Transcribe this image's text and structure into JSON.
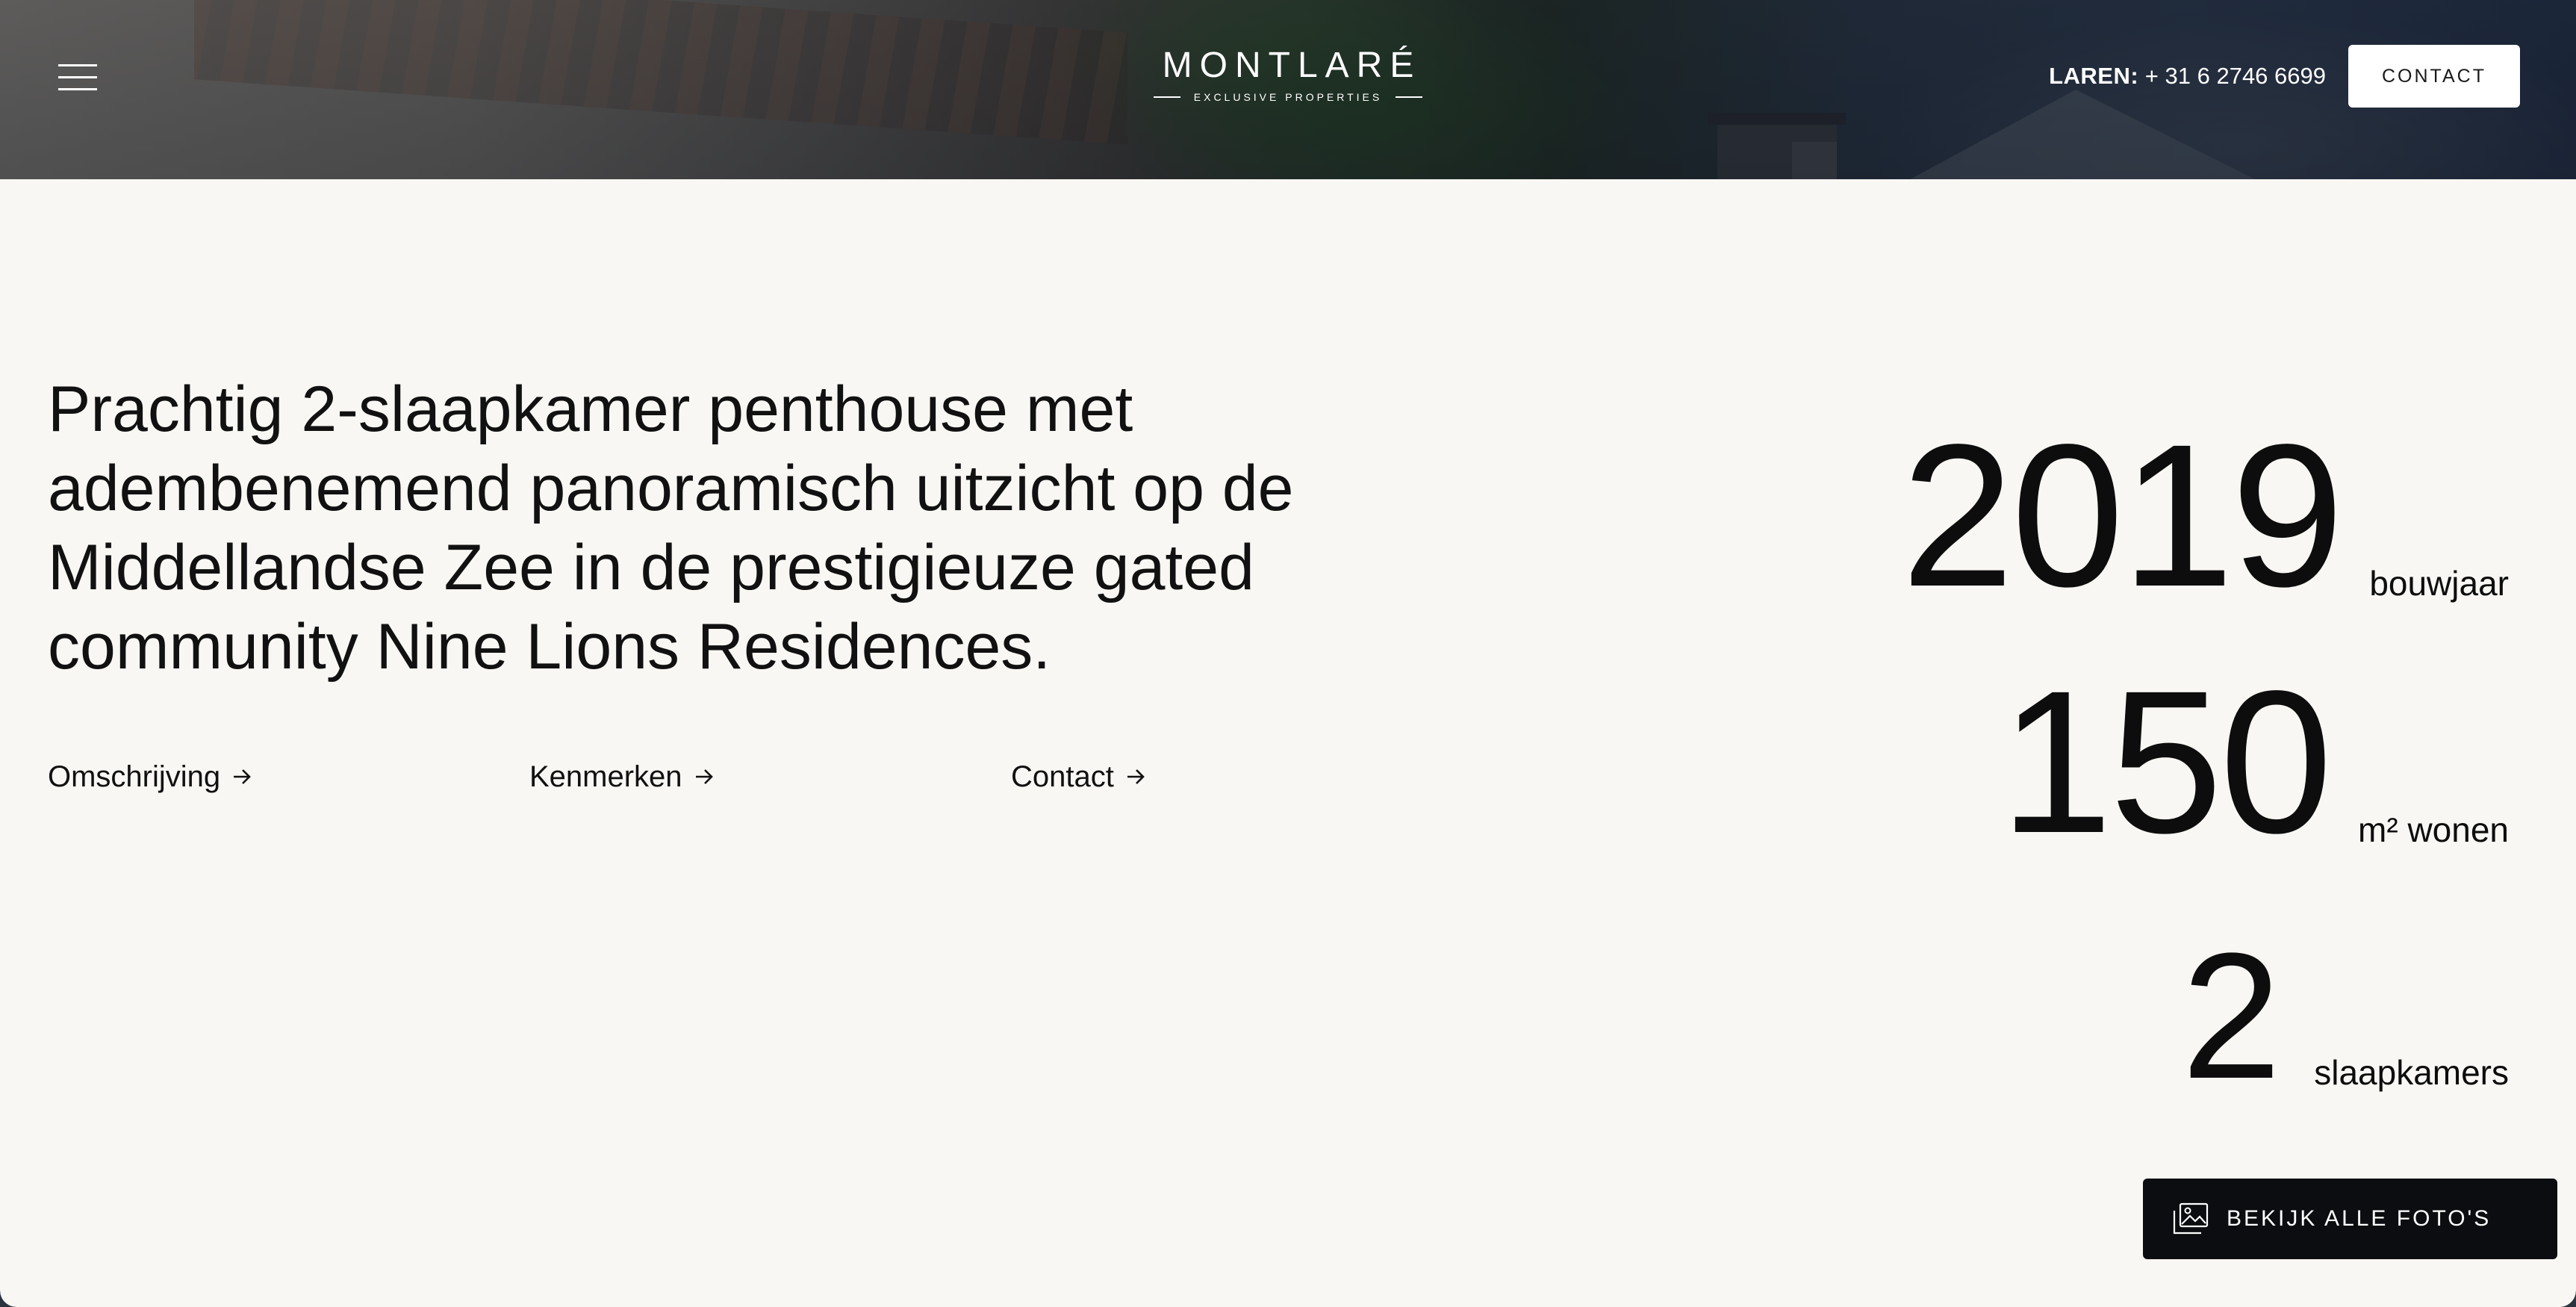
{
  "header": {
    "menu_icon": "hamburger-menu-icon",
    "logo": {
      "brand": "MONTLARÉ",
      "tagline": "EXCLUSIVE PROPERTIES"
    },
    "phone": {
      "city": "LAREN:",
      "number": "+ 31 6 2746 6699"
    },
    "contact_label": "CONTACT"
  },
  "main": {
    "headline": "Prachtig 2-slaapkamer penthouse met adembenemend panoramisch uitzicht op de Middellandse Zee in de prestigieuze gated community Nine Lions Residences.",
    "links": [
      {
        "label": "Omschrijving",
        "icon": "arrow-right-icon"
      },
      {
        "label": "Kenmerken",
        "icon": "arrow-right-icon"
      },
      {
        "label": "Contact",
        "icon": "arrow-right-icon"
      }
    ],
    "stats": [
      {
        "value": "2019",
        "unit": "bouwjaar"
      },
      {
        "value": "150",
        "unit": "m² wonen"
      },
      {
        "value": "2",
        "unit": "slaapkamers"
      }
    ],
    "photos_button": {
      "label": "BEKIJK ALLE FOTO'S",
      "icon": "gallery-icon"
    }
  },
  "colors": {
    "background": "#f8f7f3",
    "text": "#111111",
    "button_dark": "#0b0d10",
    "button_light": "#ffffff"
  }
}
